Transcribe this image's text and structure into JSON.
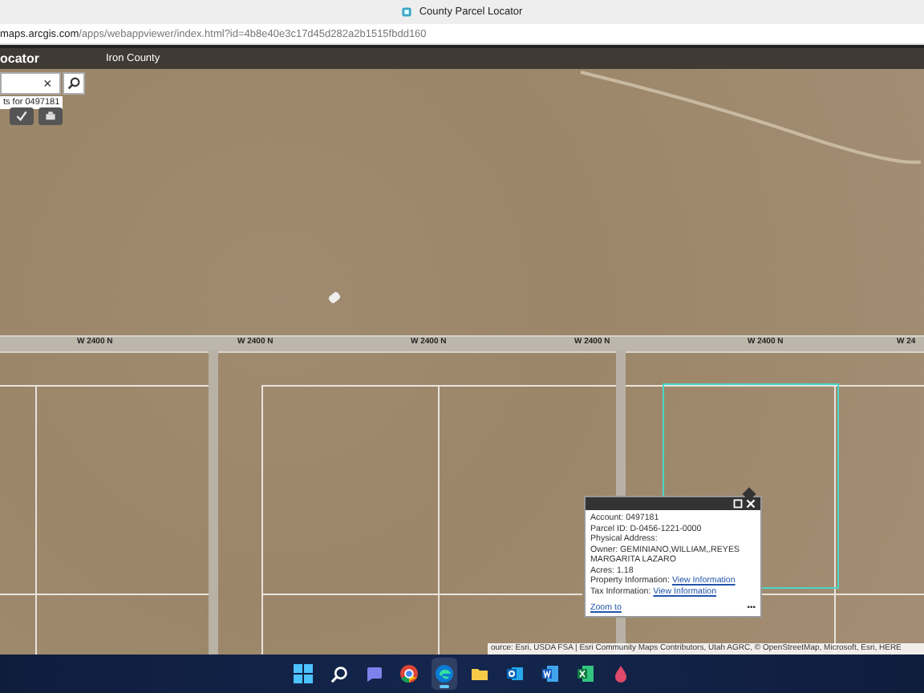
{
  "browser": {
    "tab_title": "County Parcel Locator",
    "url_host": "maps.arcgis.com",
    "url_path": "/apps/webappviewer/index.html?id=4b8e40e3c17d45d282a2b1515fbdd160"
  },
  "app_header": {
    "title": "ocator",
    "subtitle": "Iron County"
  },
  "search": {
    "clear": "×",
    "results_label": "ts for 0497181"
  },
  "map": {
    "road_labels": [
      "W 2400 N",
      "W 2400 N",
      "W 2400 N",
      "W 2400 N",
      "W 2400 N",
      "W 24"
    ],
    "attribution": "ource: Esri, USDA FSA | Esri Community Maps Contributors, Utah AGRC, © OpenStreetMap, Microsoft, Esri, HERE"
  },
  "popup": {
    "fields": [
      {
        "label": "Account:",
        "value": "0497181",
        "kind": "text"
      },
      {
        "label": "Parcel ID:",
        "value": "D-0456-1221-0000",
        "kind": "text"
      },
      {
        "label": "Physical Address:",
        "kind": "text"
      },
      {
        "label": "Owner:",
        "value": "GEMINIANO,WILLIAM,,REYES MARGARITA LAZARO",
        "kind": "text"
      },
      {
        "label": "Acres:",
        "value": "1.18",
        "kind": "text"
      },
      {
        "label": "Property Information:",
        "value": "View Information",
        "kind": "link"
      },
      {
        "label": "Tax Information:",
        "value": "View Information",
        "kind": "link"
      }
    ],
    "zoom_link": "Zoom to",
    "more": "•••"
  },
  "taskbar": {
    "apps": [
      {
        "kind": "start",
        "selected": false
      },
      {
        "kind": "search",
        "selected": false
      },
      {
        "kind": "chat",
        "selected": false
      },
      {
        "kind": "chrome",
        "selected": false
      },
      {
        "kind": "edge",
        "selected": true
      },
      {
        "kind": "folder",
        "selected": false
      },
      {
        "kind": "mail",
        "selected": false
      },
      {
        "kind": "word",
        "selected": false
      },
      {
        "kind": "excel",
        "selected": false
      },
      {
        "kind": "drop",
        "selected": false
      }
    ]
  }
}
